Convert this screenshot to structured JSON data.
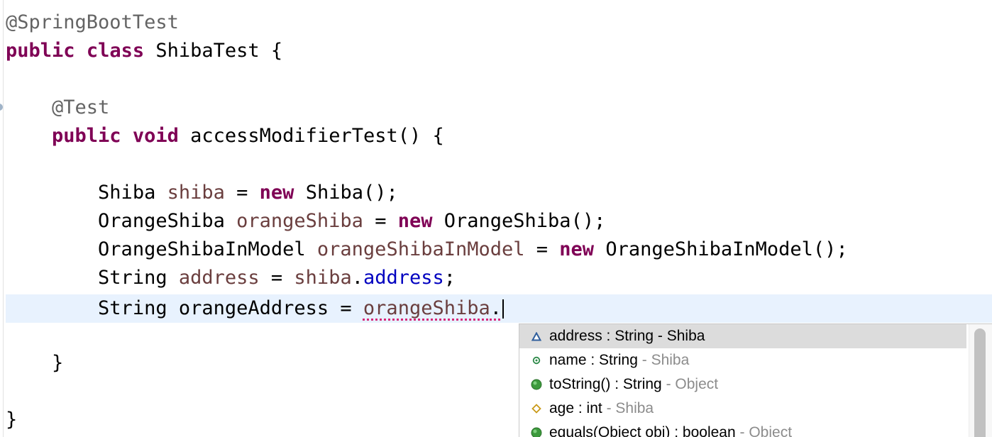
{
  "editor": {
    "lines": {
      "l1": {
        "ann": "@SpringBootTest"
      },
      "l2": {
        "kw1": "public",
        "kw2": "class",
        "rest": " ShibaTest {"
      },
      "l4": {
        "ann": "@Test"
      },
      "l5": {
        "kw1": "public",
        "kw2": "void",
        "rest": " accessModifierTest() {"
      },
      "l7": {
        "type": "Shiba ",
        "var": "shiba",
        "eq": " = ",
        "kw": "new",
        "rest": " Shiba();"
      },
      "l8": {
        "type": "OrangeShiba ",
        "var": "orangeShiba",
        "eq": " = ",
        "kw": "new",
        "rest": " OrangeShiba();"
      },
      "l9": {
        "type": "OrangeShibaInModel ",
        "var": "orangeShibaInModel",
        "eq": " = ",
        "kw": "new",
        "rest": " OrangeShibaInModel();"
      },
      "l10": {
        "type": "String ",
        "var": "address",
        "eq": " = ",
        "obj": "shiba",
        "dot": ".",
        "field": "address",
        "semi": ";"
      },
      "l11": {
        "type": "String orangeAddress = ",
        "obj": "orangeShiba",
        "dot": "."
      },
      "l13": {
        "brace": "}"
      },
      "l15": {
        "brace": "}"
      }
    }
  },
  "completion": {
    "items": [
      {
        "icon": "protected-field-icon",
        "name": "address : String",
        "qualifier": " - Shiba",
        "selected": true
      },
      {
        "icon": "private-field-icon",
        "name": "name : String",
        "qualifier": " - Shiba",
        "selected": false
      },
      {
        "icon": "public-method-icon",
        "name": "toString() : String",
        "qualifier": " - Object",
        "selected": false
      },
      {
        "icon": "default-field-icon",
        "name": "age : int",
        "qualifier": " - Shiba",
        "selected": false
      },
      {
        "icon": "public-method-icon",
        "name": "equals(Object obj) : boolean",
        "qualifier": " - Object",
        "selected": false
      }
    ]
  },
  "colors": {
    "keyword": "#7f0055",
    "annotation": "#646464",
    "local_variable": "#6a3e3e",
    "field": "#0000c0",
    "current_line": "#e8f2fe",
    "error_underline": "#d6287a",
    "selected_proposal": "#dcdcdc"
  }
}
